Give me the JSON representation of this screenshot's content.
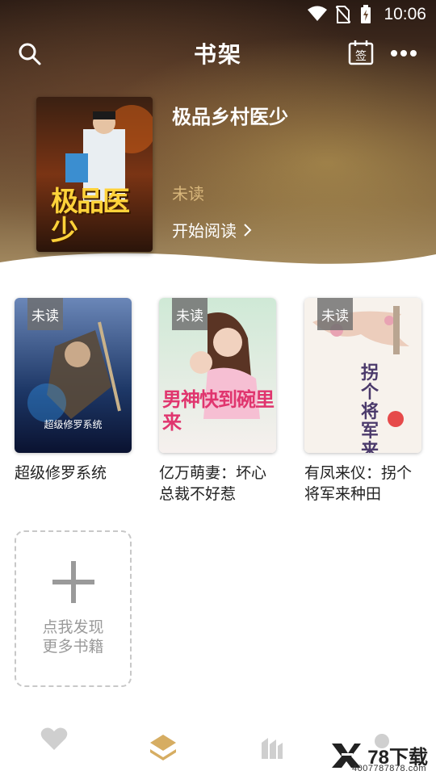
{
  "status_bar": {
    "time": "10:06"
  },
  "header": {
    "title": "书架"
  },
  "hero": {
    "book_title": "极品乡村医少",
    "status": "未读",
    "read_label": "开始阅读",
    "cover_text": "极品医少"
  },
  "books": [
    {
      "tag": "未读",
      "title": "超级修罗系统",
      "cover_caption": "超级修罗系统"
    },
    {
      "tag": "未读",
      "title": "亿万萌妻：坏心总裁不好惹",
      "cover_caption": "男神快到碗里来"
    },
    {
      "tag": "未读",
      "title": "有凤来仪：拐个将军来种田",
      "cover_caption": "拐个将军来种田"
    }
  ],
  "add_card": {
    "line1": "点我发现",
    "line2": "更多书籍"
  },
  "watermark": {
    "text": "78下载",
    "sub": "4007787878.com"
  },
  "colors": {
    "accent_gold": "#d6ad62",
    "unread_tag": "#6e6e6e",
    "nav_inactive": "#cfcfcf"
  },
  "icons": [
    "search-icon",
    "calendar-sign-icon",
    "more-icon",
    "chevron-right-icon",
    "heart-icon",
    "bookshelf-icon",
    "category-icon",
    "profile-icon",
    "plus-icon"
  ]
}
